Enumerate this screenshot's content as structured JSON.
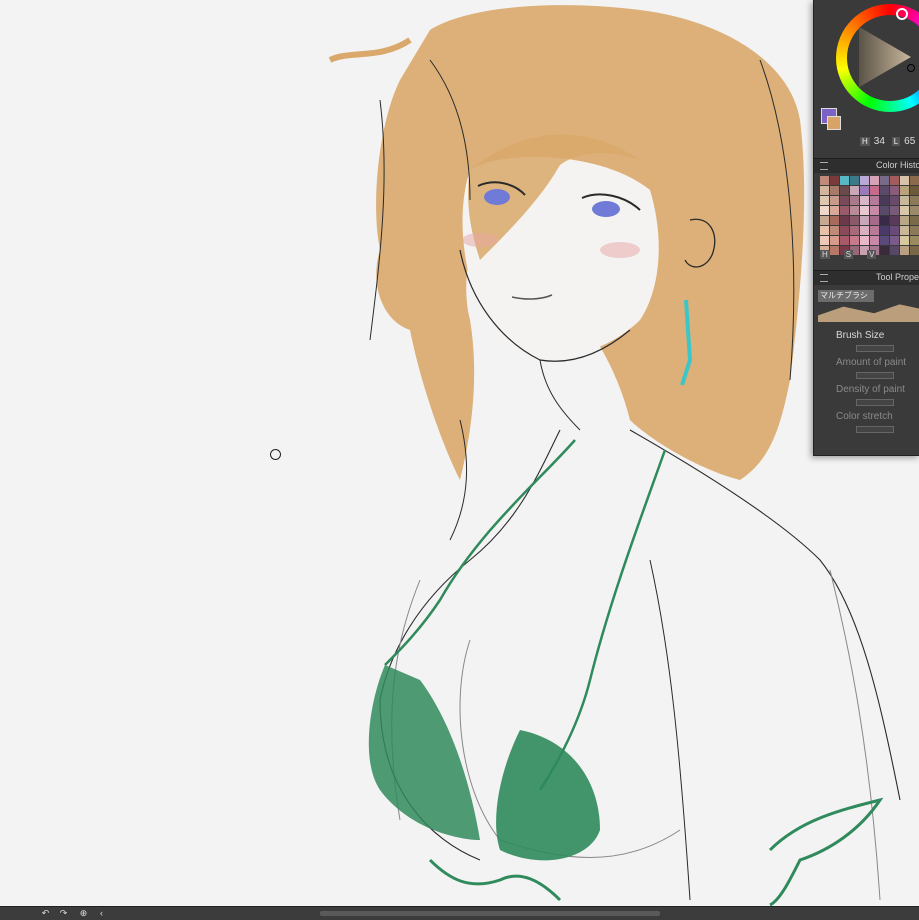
{
  "app": {
    "accent_color": "#3a3a3a"
  },
  "color_wheel": {
    "main_color": "#7b62c4",
    "sub_color": "#d7a366",
    "hsl_values": [
      "H",
      "34",
      "L",
      "65"
    ]
  },
  "color_history": {
    "title": "Color Histo",
    "labels": [
      "H",
      "S",
      "V"
    ],
    "swatches": [
      "#c28a7a",
      "#7a3a3a",
      "#56b9c4",
      "#3c7a8a",
      "#b9a8d6",
      "#d6a3b6",
      "#7a6a8a",
      "#a35c5c",
      "#d6c3a8",
      "#8a6a4a",
      "#d4b49a",
      "#a87a6a",
      "#6a4a4a",
      "#c9a8b8",
      "#9a7ab8",
      "#c86a8a",
      "#5c4a6a",
      "#8a5c7a",
      "#b8a37a",
      "#6a5a3a",
      "#e0c8b0",
      "#c89a8a",
      "#7a4a5a",
      "#a87a8a",
      "#d8b8c8",
      "#b87a9a",
      "#4a3a5a",
      "#6a4a6a",
      "#c8b89a",
      "#8a7a5a",
      "#f0d8c8",
      "#d8a89a",
      "#9a5a6a",
      "#b88a9a",
      "#e8c8d0",
      "#c88aa8",
      "#5a4a6a",
      "#7a5a7a",
      "#d8c8a8",
      "#9a8a6a",
      "#c8a890",
      "#a86a5a",
      "#6a3a4a",
      "#8a5a6a",
      "#c8a8b8",
      "#a86a8a",
      "#3a2a4a",
      "#5a3a5a",
      "#b8a888",
      "#7a6a4a",
      "#e8c0a8",
      "#c08a7a",
      "#8a4a5a",
      "#a86a7a",
      "#d8b0c0",
      "#b87a98",
      "#4a3a6a",
      "#6a4a7a",
      "#c8b898",
      "#8a7a58",
      "#f0c8b8",
      "#d89a8a",
      "#a85a6a",
      "#c87a8a",
      "#e8b8c8",
      "#c888a8",
      "#5a4a7a",
      "#7a5a8a",
      "#d8c8a0",
      "#9a8a60",
      "#d8b098",
      "#b87868",
      "#7a3848",
      "#986878",
      "#c8a0b0",
      "#a87890",
      "#3a2a3a",
      "#584868",
      "#b8a080",
      "#786848"
    ]
  },
  "tool_property": {
    "title": "Tool Proper",
    "brush_name": "マルチブラシ",
    "brush_color": "#d2b288",
    "properties": [
      {
        "label": "Brush Size",
        "dim": false
      },
      {
        "label": "Amount of paint",
        "dim": true
      },
      {
        "label": "Density of paint",
        "dim": true
      },
      {
        "label": "Color stretch",
        "dim": true
      }
    ]
  },
  "statusbar": {
    "buttons": [
      "↶",
      "↷",
      "⊕",
      "‹"
    ]
  },
  "artwork": {
    "hair_color": "#d9a86a",
    "lineart_color": "#2a2a2a",
    "bikini_color": "#2f8a5c",
    "eye_color": "#6f7bd6",
    "earring_color": "#3cc6c8"
  }
}
